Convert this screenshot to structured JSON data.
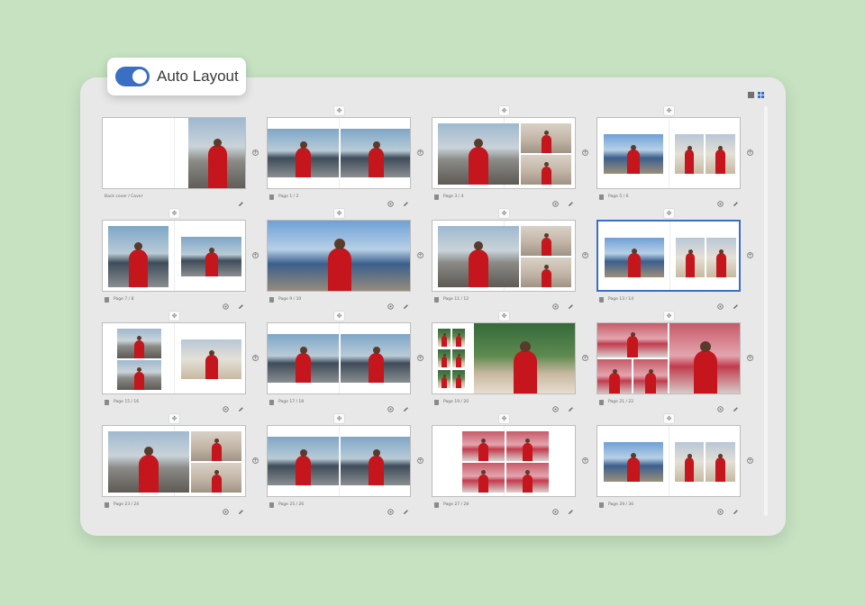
{
  "toggle": {
    "label": "Auto Layout",
    "on": true
  },
  "colors": {
    "accent": "#3b6fc4",
    "background": "#c6e2c1",
    "panel": "#e8e8e8"
  },
  "view_switch": {
    "single_icon": "single-page-view-icon",
    "grid_icon": "grid-view-icon",
    "active": "grid"
  },
  "spreads": [
    {
      "label": "Back cover / Cover",
      "selected": false,
      "layout": "cover"
    },
    {
      "label": "Page 1 / 2",
      "selected": false,
      "layout": "two-full"
    },
    {
      "label": "Page 3 / 4",
      "selected": false,
      "layout": "one-plus-two"
    },
    {
      "label": "Page 5 / 6",
      "selected": false,
      "layout": "one-plus-two-small"
    },
    {
      "label": "Page 7 / 8",
      "selected": false,
      "layout": "two-small"
    },
    {
      "label": "Page 9 / 10",
      "selected": false,
      "layout": "panorama"
    },
    {
      "label": "Page 11 / 12",
      "selected": false,
      "layout": "one-plus-two"
    },
    {
      "label": "Page 13 / 14",
      "selected": true,
      "layout": "one-plus-two-small"
    },
    {
      "label": "Page 15 / 16",
      "selected": false,
      "layout": "two-stack-plus-one"
    },
    {
      "label": "Page 17 / 18",
      "selected": false,
      "layout": "two-full"
    },
    {
      "label": "Page 19 / 20",
      "selected": false,
      "layout": "strip-plus-one"
    },
    {
      "label": "Page 21 / 22",
      "selected": false,
      "layout": "mosaic"
    },
    {
      "label": "Page 23 / 24",
      "selected": false,
      "layout": "one-plus-two"
    },
    {
      "label": "Page 25 / 26",
      "selected": false,
      "layout": "two-full"
    },
    {
      "label": "Page 27 / 28",
      "selected": false,
      "layout": "grid-four"
    },
    {
      "label": "Page 29 / 30",
      "selected": false,
      "layout": "one-plus-two-small"
    }
  ]
}
